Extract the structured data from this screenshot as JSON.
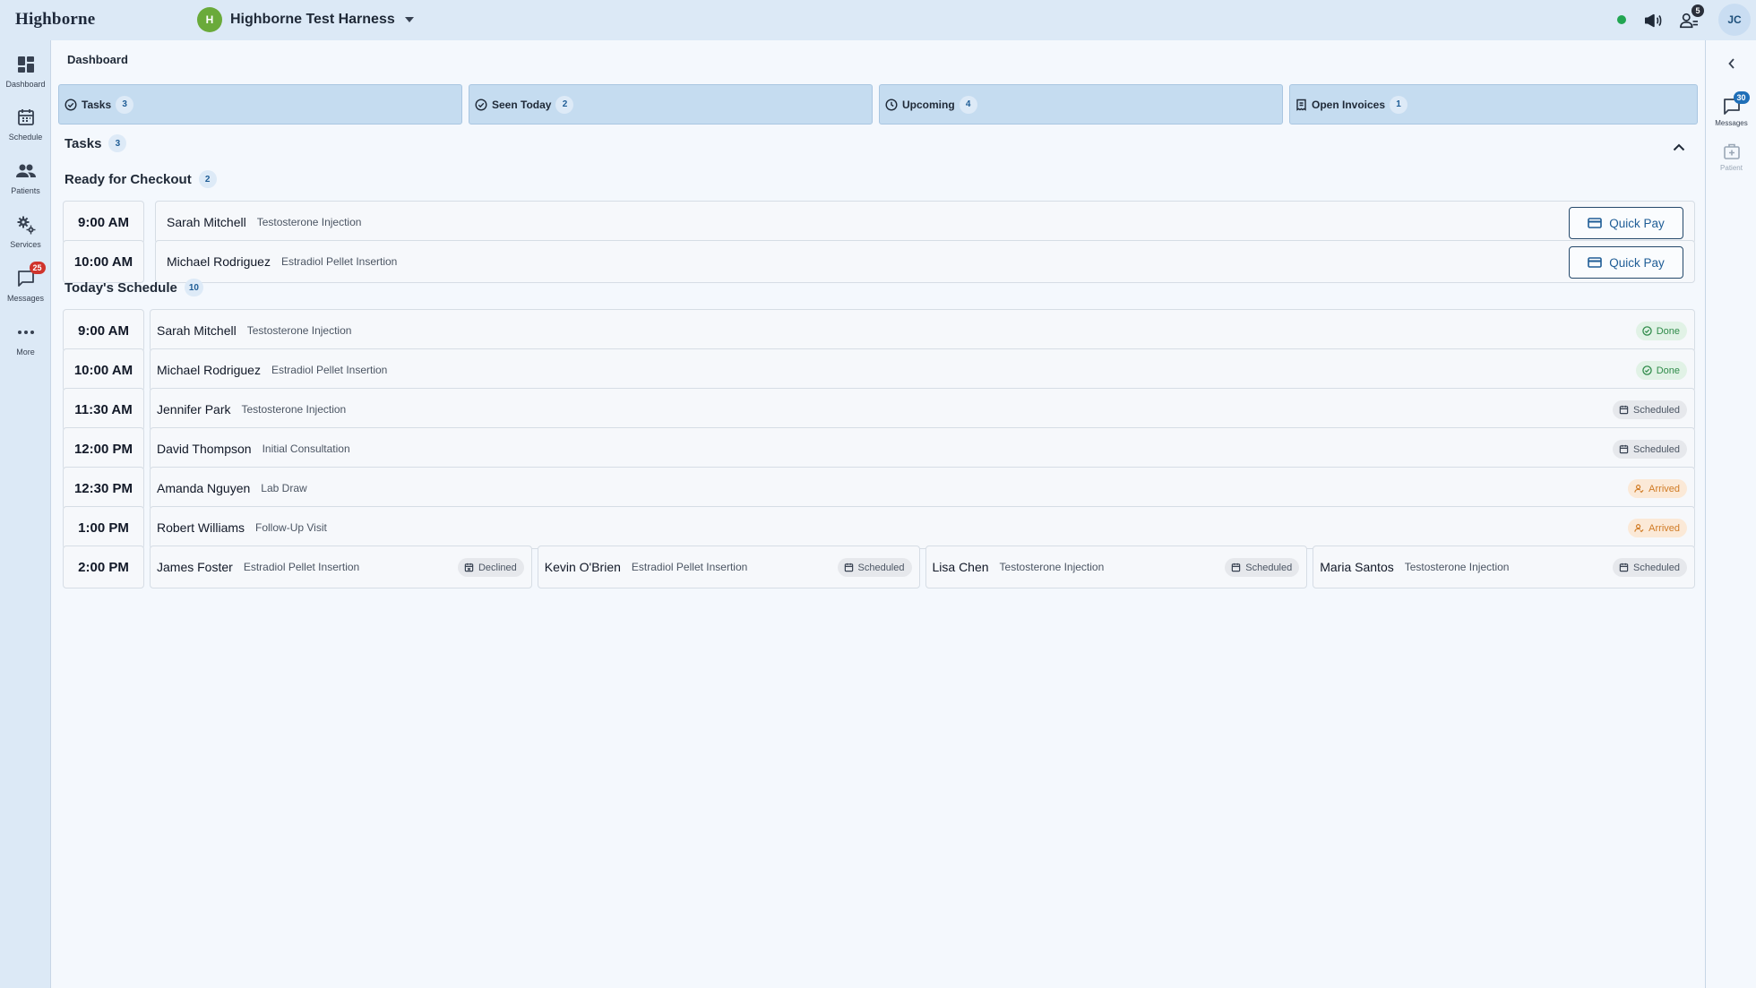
{
  "app": {
    "brand": "Highborne",
    "org_initial": "H",
    "org_name": "Highborne Test Harness",
    "user_initials": "JC"
  },
  "topbar": {
    "people_badge": "5",
    "status_color": "#22a652"
  },
  "leftnav": {
    "items": [
      {
        "label": "Dashboard",
        "icon": "dashboard-icon"
      },
      {
        "label": "Schedule",
        "icon": "calendar-icon"
      },
      {
        "label": "Patients",
        "icon": "people-icon"
      },
      {
        "label": "Services",
        "icon": "gears-icon"
      },
      {
        "label": "Messages",
        "icon": "chat-icon",
        "badge": "25"
      },
      {
        "label": "More",
        "icon": "more-icon"
      }
    ]
  },
  "rightpanel": {
    "items": [
      {
        "label": "Messages",
        "icon": "chat-icon",
        "badge": "30"
      },
      {
        "label": "Patient",
        "icon": "patient-icon"
      }
    ]
  },
  "page": {
    "title": "Dashboard"
  },
  "tabs": [
    {
      "label": "Tasks",
      "count": "3",
      "icon": "check-circle-icon"
    },
    {
      "label": "Seen Today",
      "count": "2",
      "icon": "check-circle-icon"
    },
    {
      "label": "Upcoming",
      "count": "4",
      "icon": "clock-icon"
    },
    {
      "label": "Open Invoices",
      "count": "1",
      "icon": "invoice-icon"
    }
  ],
  "tasks": {
    "title": "Tasks",
    "count": "3",
    "checkout": {
      "title": "Ready for Checkout",
      "count": "2",
      "quick_pay_label": "Quick Pay",
      "rows": [
        {
          "time": "9:00 AM",
          "name": "Sarah Mitchell",
          "service": "Testosterone Injection"
        },
        {
          "time": "10:00 AM",
          "name": "Michael Rodriguez",
          "service": "Estradiol Pellet Insertion"
        }
      ]
    },
    "schedule": {
      "title": "Today's Schedule",
      "count": "10",
      "rows": [
        {
          "time": "9:00 AM",
          "appts": [
            {
              "name": "Sarah Mitchell",
              "service": "Testosterone Injection",
              "status": "Done"
            }
          ]
        },
        {
          "time": "10:00 AM",
          "appts": [
            {
              "name": "Michael Rodriguez",
              "service": "Estradiol Pellet Insertion",
              "status": "Done"
            }
          ]
        },
        {
          "time": "11:30 AM",
          "appts": [
            {
              "name": "Jennifer Park",
              "service": "Testosterone Injection",
              "status": "Scheduled"
            }
          ]
        },
        {
          "time": "12:00 PM",
          "appts": [
            {
              "name": "David Thompson",
              "service": "Initial Consultation",
              "status": "Scheduled"
            }
          ]
        },
        {
          "time": "12:30 PM",
          "appts": [
            {
              "name": "Amanda Nguyen",
              "service": "Lab Draw",
              "status": "Arrived"
            }
          ]
        },
        {
          "time": "1:00 PM",
          "appts": [
            {
              "name": "Robert Williams",
              "service": "Follow-Up Visit",
              "status": "Arrived"
            }
          ]
        },
        {
          "time": "2:00 PM",
          "appts": [
            {
              "name": "James Foster",
              "service": "Estradiol Pellet Insertion",
              "status": "Declined"
            },
            {
              "name": "Kevin O'Brien",
              "service": "Estradiol Pellet Insertion",
              "status": "Scheduled"
            },
            {
              "name": "Lisa Chen",
              "service": "Testosterone Injection",
              "status": "Scheduled"
            },
            {
              "name": "Maria Santos",
              "service": "Testosterone Injection",
              "status": "Scheduled"
            }
          ]
        }
      ]
    }
  }
}
